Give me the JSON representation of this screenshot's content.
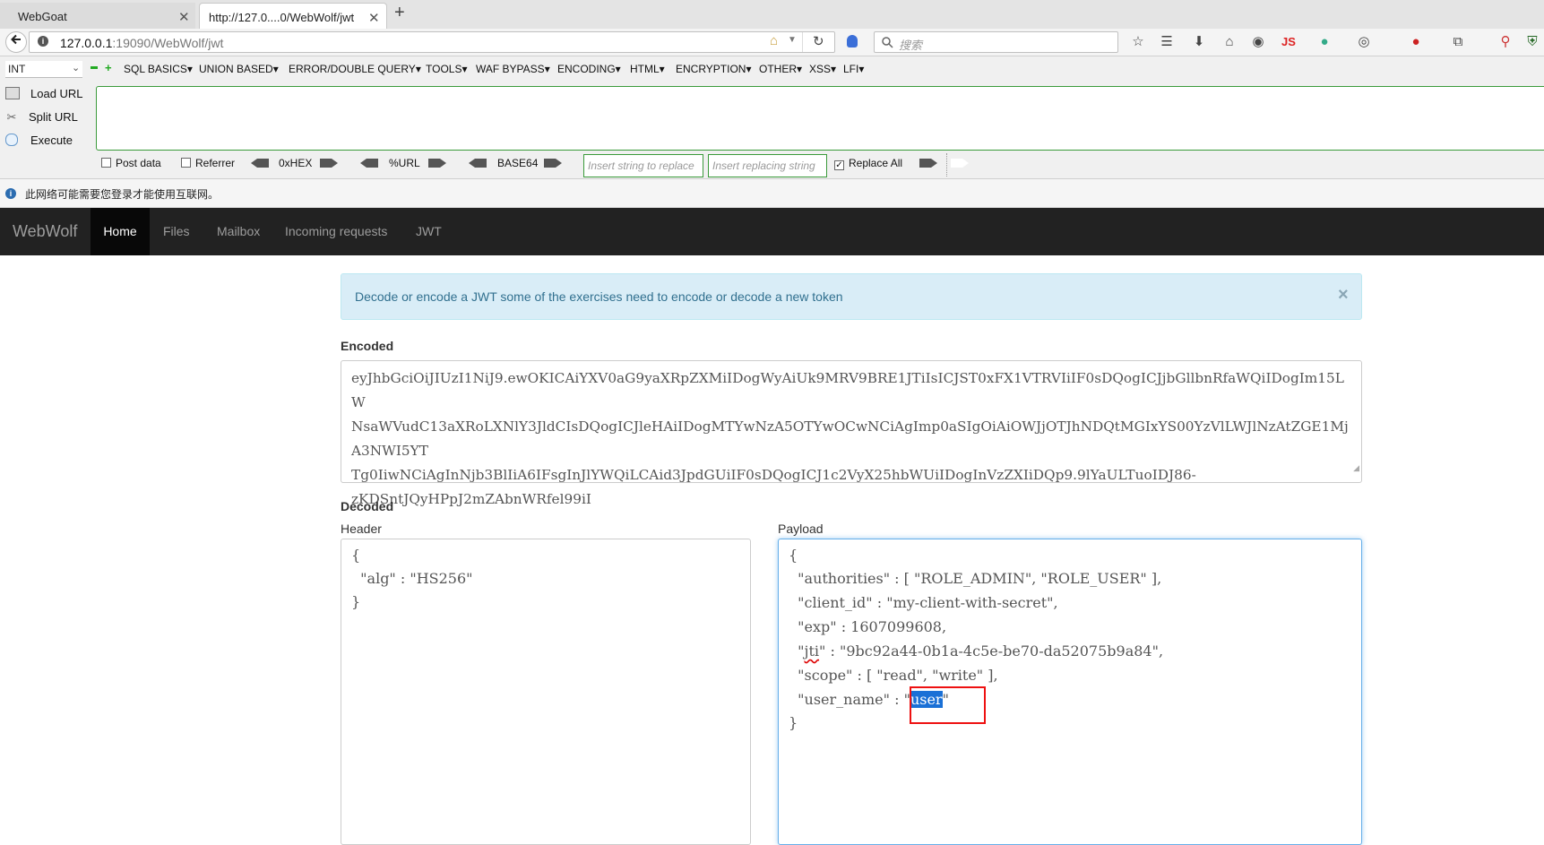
{
  "browser": {
    "tabs": [
      {
        "title": "WebGoat",
        "active": false
      },
      {
        "title": "http://127.0....0/WebWolf/jwt",
        "active": true
      }
    ],
    "new_tab": "+",
    "close_glyph": "✕",
    "url_host": "127.0.0.1",
    "url_rest": ":19090/WebWolf/jwt",
    "search_placeholder": "搜索",
    "js_badge": "JS"
  },
  "hackbar": {
    "select_value": "INT",
    "menus": [
      "SQL BASICS",
      "UNION BASED",
      "ERROR/DOUBLE QUERY",
      "TOOLS",
      "WAF BYPASS",
      "ENCODING",
      "HTML",
      "ENCRYPTION",
      "OTHER",
      "XSS",
      "LFI"
    ],
    "load_url": "Load URL",
    "split_url": "Split URL",
    "execute": "Execute",
    "post_data": "Post data",
    "referrer": "Referrer",
    "hex": "0xHEX",
    "url": "%URL",
    "base64": "BASE64",
    "insert_string_placeholder": "Insert string to replace",
    "insert_replacing_placeholder": "Insert replacing string",
    "replace_all": "Replace All"
  },
  "infobar": {
    "text": "此网络可能需要您登录才能使用互联网。"
  },
  "webwolf": {
    "brand": "WebWolf",
    "nav": [
      "Home",
      "Files",
      "Mailbox",
      "Incoming requests",
      "JWT"
    ],
    "active_nav": "Home"
  },
  "alert": {
    "text": "Decode or encode a JWT some of the exercises need to encode or decode a new token",
    "close": "×"
  },
  "encoded": {
    "label": "Encoded",
    "lines": [
      "eyJhbGciOiJIUzI1NiJ9.ewOKICAiYXV0aG9yaXRpZXMiIDogWyAiUk9MRV9BRE1JTiIsICJST0xFX1VTRVIiIF0sDQogICJjbGllbnRfaWQiIDogIm15LW",
      "NsaWVudC13aXRoLXNlY3JldCIsDQogICJleHAiIDogMTYwNzA5OTYwOCwNCiAgImp0aSIgOiAiOWJjOTJhNDQtMGIxYS00YzVlLWJlNzAtZGE1MjA3NWI5YT",
      "Tg0IiwNCiAgInNjb3BlIiA6IFsgInJlYWQiLCAid3JpdGUiIF0sDQogICJ1c2VyX25hbWUiIDogInVzZXIiDQp9.9lYaULTuoIDJ86-",
      "zKDSntJQyHPpJ2mZAbnWRfel99iI"
    ]
  },
  "decoded": {
    "label": "Decoded",
    "header_label": "Header",
    "payload_label": "Payload",
    "header_lines": [
      "{",
      "  \"alg\" : \"HS256\"",
      "}"
    ],
    "payload": {
      "open": "{",
      "l1": "  \"authorities\" : [ \"ROLE_ADMIN\", \"ROLE_USER\" ],",
      "l2": "  \"client_id\" : \"my-client-with-secret\",",
      "l3": "  \"exp\" : 1607099608,",
      "l4_pre": "  \"",
      "l4_key": "jti",
      "l4_post": "\" : \"9bc92a44-0b1a-4c5e-be70-da52075b9a84\",",
      "l5": "  \"scope\" : [ \"read\", \"write\" ],",
      "l6_pre": "  \"user_name\" : \"",
      "l6_sel": "user",
      "l6_post": "\"",
      "close": "}"
    }
  }
}
